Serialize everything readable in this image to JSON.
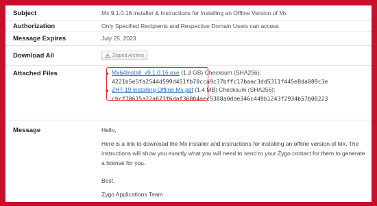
{
  "fields": {
    "subject_label": "Subject",
    "subject_value": "Mx 9.1.0.16 installer & Instructions for Installing an Offline Version of Mx",
    "authorization_label": "Authorization",
    "authorization_value": "Only Specified Recipients and Respective Domain Users can access",
    "expires_label": "Message Expires",
    "expires_value": "July 25, 2023",
    "download_label": "Download All",
    "download_button": "Zipped Archive",
    "attached_label": "Attached Files",
    "message_label": "Message"
  },
  "files": [
    {
      "name": "Mx64Install_v9.1.0.16.exe",
      "size": "(1.3 GB)",
      "checksum_label": "Checksum (SHA256):",
      "hash": "4221b5e5fa2544d599d451fb70cca9c37bffc17baac3dd5311f445e8da089c3e"
    },
    {
      "name": "ZHT-19 Installing Offline Mx.pdf",
      "size": "(1.4 MB)",
      "checksum_label": "Checksum (SHA256):",
      "hash": "cbcf78615a22a673f6daf36004aec5388a0dde346c449b1243f2934b57b00223"
    }
  ],
  "message": {
    "greeting": "Hello,",
    "body": "Here is a link to download the Mx installer and instructions for installing an offline version of Mx. The instructions will show you exactly what you will need to send to your Zygo contact for them to generate a license for you.",
    "closing": "Best,",
    "signature": "Zygo Applications Team"
  },
  "colors": {
    "frame": "#c8102e",
    "link": "#2a6fc9",
    "highlight": "#e0272f"
  }
}
